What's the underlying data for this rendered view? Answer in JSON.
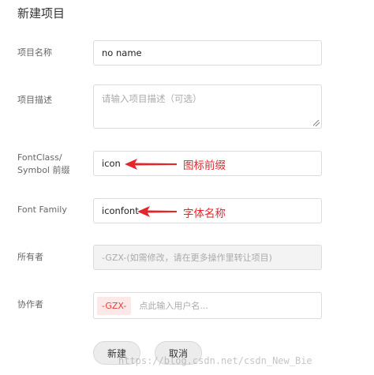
{
  "header": {
    "title": "新建项目"
  },
  "form": {
    "name": {
      "label": "项目名称",
      "value": "no name"
    },
    "description": {
      "label": "项目描述",
      "placeholder": "请输入项目描述（可选）"
    },
    "prefix": {
      "label_line1": "FontClass/",
      "label_line2": "Symbol 前缀",
      "value": "icon",
      "annotation": "图标前缀"
    },
    "font_family": {
      "label": "Font Family",
      "value": "iconfont",
      "annotation": "字体名称"
    },
    "owner": {
      "label": "所有者",
      "value": "-GZX-(如需修改，请在更多操作里转让项目)"
    },
    "collaborators": {
      "label": "协作者",
      "tag": "-GZX-",
      "placeholder": "点此输入用户名..."
    }
  },
  "actions": {
    "create_label": "新建",
    "cancel_label": "取消"
  },
  "watermark": "https://blog.csdn.net/csdn_New_Bie",
  "colors": {
    "annotation_red": "#e3262b",
    "tag_bg": "#fde8e8",
    "tag_text": "#e0413b"
  },
  "icons": [
    "arrow-left-icon",
    "resize-handle-icon"
  ]
}
